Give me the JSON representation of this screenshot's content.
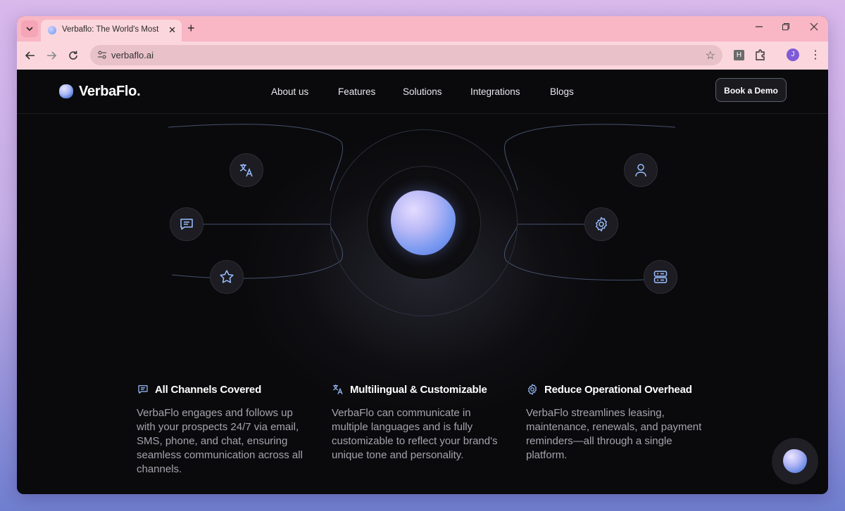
{
  "browser": {
    "tab_title": "Verbaflo: The World's Most Ada",
    "new_tab": "+",
    "tab_close": "✕",
    "url": "verbaflo.ai",
    "extension_h": "H",
    "profile_initial": "J"
  },
  "site": {
    "logo_text": "VerbaFlo.",
    "nav": [
      "About us",
      "Features",
      "Solutions",
      "Integrations",
      "Blogs"
    ],
    "cta": "Book a Demo"
  },
  "hero": {
    "left_nodes": [
      "translate-icon",
      "chat-icon",
      "star-icon"
    ],
    "right_nodes": [
      "user-icon",
      "gear-icon",
      "server-icon"
    ]
  },
  "features": [
    {
      "icon": "chat-icon",
      "title": "All Channels Covered",
      "desc": "VerbaFlo engages and follows up with your prospects 24/7 via email, SMS, phone, and chat, ensuring seamless communication across all channels."
    },
    {
      "icon": "translate-icon",
      "title": "Multilingual & Customizable",
      "desc": "VerbaFlo can communicate in multiple languages and is fully customizable to reflect your brand's unique tone and personality."
    },
    {
      "icon": "gear-icon",
      "title": "Reduce Operational Overhead",
      "desc": "VerbaFlo streamlines leasing, maintenance, renewals, and payment reminders—all through a single platform."
    }
  ],
  "colors": {
    "accent_blue": "#8ab4f8",
    "page_bg": "#0a0a0c",
    "tab_bar": "#f9b6c4"
  }
}
